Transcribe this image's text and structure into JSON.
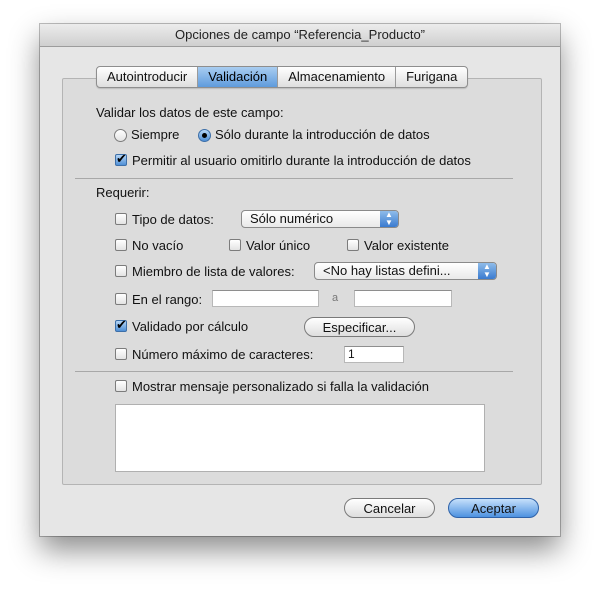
{
  "window": {
    "title": "Opciones de campo “Referencia_Producto”"
  },
  "tabs": [
    {
      "label": "Autointroducir",
      "active": false
    },
    {
      "label": "Validación",
      "active": true
    },
    {
      "label": "Almacenamiento",
      "active": false
    },
    {
      "label": "Furigana",
      "active": false
    }
  ],
  "validate": {
    "heading": "Validar los datos de este campo:",
    "always_label": "Siempre",
    "always_selected": false,
    "only_entry_label": "Sólo durante la introducción de datos",
    "only_entry_selected": true,
    "allow_override_label": "Permitir al usuario omitirlo durante la introducción de datos",
    "allow_override_checked": true
  },
  "require": {
    "heading": "Requerir:",
    "data_type_label": "Tipo de datos:",
    "data_type_checked": false,
    "data_type_value": "Sólo numérico",
    "not_empty_label": "No vacío",
    "not_empty_checked": false,
    "unique_label": "Valor único",
    "unique_checked": false,
    "existing_label": "Valor existente",
    "existing_checked": false,
    "value_list_label": "Miembro de lista de valores:",
    "value_list_checked": false,
    "value_list_value": "<No hay listas defini...",
    "range_label": "En el rango:",
    "range_checked": false,
    "range_from": "",
    "range_to_label": "a",
    "range_to": "",
    "calc_label": "Validado por cálculo",
    "calc_checked": true,
    "specify_label": "Especificar...",
    "max_chars_label": "Número máximo de caracteres:",
    "max_chars_checked": false,
    "max_chars_value": "1"
  },
  "message": {
    "label": "Mostrar mensaje personalizado si falla la validación",
    "checked": false,
    "text": ""
  },
  "buttons": {
    "cancel": "Cancelar",
    "ok": "Aceptar"
  },
  "colors": {
    "accent": "#4d92e0",
    "dialog_bg": "#e6e6e6"
  }
}
